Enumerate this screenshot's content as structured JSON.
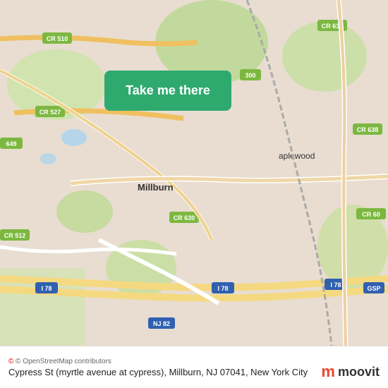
{
  "map": {
    "bg_color": "#e8e0d8",
    "alt_text": "Map of Millburn NJ area"
  },
  "button": {
    "label": "Take me there",
    "bg_color": "#2eaa6e",
    "text_color": "#ffffff"
  },
  "bottom_bar": {
    "attribution": "© OpenStreetMap contributors",
    "address": "Cypress St (myrtle avenue at cypress), Millburn, NJ 07041, New York City"
  },
  "moovit": {
    "logo_text": "moovit"
  }
}
